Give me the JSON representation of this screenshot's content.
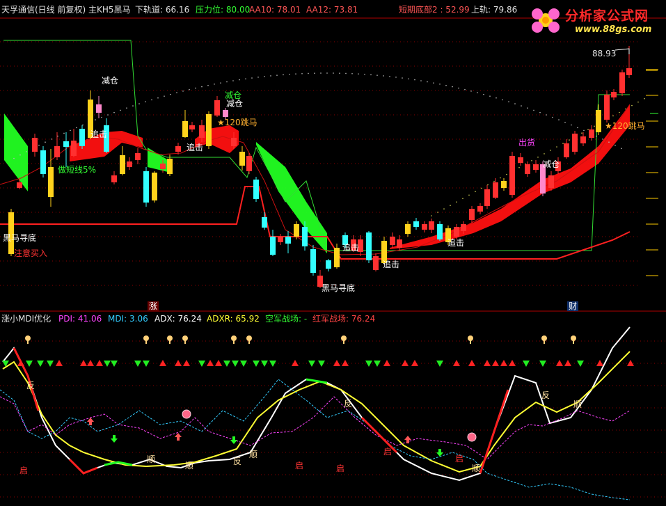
{
  "top_header": {
    "title": "天孚通信(日线 前复权) 主KH5黑马",
    "down_track": "下轨道: 66.16",
    "pressure": "压力位: 80.00",
    "aa10": "AA10: 78.01",
    "aa12": "AA12: 73.81",
    "short_bottom": "短期底部2 : 52.99",
    "up_track": "上轨: 79.86",
    "title_color": "#e0e0e0",
    "down_color": "#e0e0e0",
    "pressure_color": "#33ff33",
    "aa10_color": "#ff5555",
    "aa12_color": "#ff5555",
    "short_bottom_color": "#ff5555",
    "up_track_color": "#e0e0e0"
  },
  "logo": {
    "name": "分析家公式网",
    "url": "www.88gs.com"
  },
  "price_panel": {
    "high_marker": "88.93",
    "annotations": [
      {
        "text": "减仓",
        "color": "#ffffff"
      },
      {
        "text": "减仓",
        "color": "#33ff33"
      },
      {
        "text": "减仓",
        "color": "#ffffff"
      },
      {
        "text": "★120跳马",
        "color": "#ffb030"
      },
      {
        "text": "追击",
        "color": "#ffffff"
      },
      {
        "text": "追击",
        "color": "#ffffff"
      },
      {
        "text": "做短线5%",
        "color": "#33ff33"
      },
      {
        "text": "黑马寻底",
        "color": "#ffffff"
      },
      {
        "text": "注意买入",
        "color": "#ff3333"
      },
      {
        "text": "追击",
        "color": "#ffffff"
      },
      {
        "text": "黑马寻底",
        "color": "#ffffff"
      },
      {
        "text": "追击",
        "color": "#ffffff"
      },
      {
        "text": "追击",
        "color": "#ffffff"
      },
      {
        "text": "出货",
        "color": "#ff44ff"
      },
      {
        "text": "减仓",
        "color": "#ffffff"
      },
      {
        "text": "★120跳马",
        "color": "#ffb030"
      }
    ],
    "bottom_tags": [
      {
        "text": "涨"
      },
      {
        "text": "财"
      }
    ]
  },
  "indicator_header": {
    "name": "涨小MDI优化",
    "pdi": "PDI: 41.06",
    "mdi": "MDI: 3.06",
    "adx": "ADX: 76.24",
    "adxr": "ADXR: 65.92",
    "kong": "空军战场: -",
    "hong": "红军战场: 76.24",
    "pdi_color": "#ff44ff",
    "mdi_color": "#33ccff",
    "adx_color": "#ffffff",
    "adxr_color": "#ffff33",
    "kong_color": "#33ff33",
    "hong_color": "#ff4444"
  },
  "indicator_labels": [
    {
      "text": "反",
      "color": "#ffe0a0"
    },
    {
      "text": "启",
      "color": "#ff3333"
    },
    {
      "text": "顺",
      "color": "#ffe0a0"
    },
    {
      "text": "顺",
      "color": "#ffe0a0"
    },
    {
      "text": "反",
      "color": "#ffe0a0"
    },
    {
      "text": "顺",
      "color": "#ffe0a0"
    },
    {
      "text": "启",
      "color": "#ff3333"
    },
    {
      "text": "启",
      "color": "#ff3333"
    },
    {
      "text": "反",
      "color": "#ffe0a0"
    },
    {
      "text": "启",
      "color": "#ff3333"
    },
    {
      "text": "启",
      "color": "#ff3333"
    },
    {
      "text": "顺",
      "color": "#ffe0a0"
    },
    {
      "text": "反",
      "color": "#ffe0a0"
    },
    {
      "text": "顺",
      "color": "#ffe0a0"
    }
  ],
  "colors": {
    "up": "#ff3030",
    "down": "#33ffff",
    "yellow": "#ffd21c",
    "pink": "#ff88cc",
    "green_band": "#22ff22",
    "red_band": "#ff1010",
    "grid": "#8b0000"
  }
}
